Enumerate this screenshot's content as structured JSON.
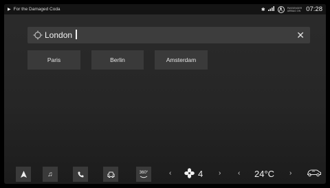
{
  "status": {
    "media_title": "For the Damaged Coda",
    "airbag_label_line1": "PASSENGER",
    "airbag_label_line2": "AIRBAG ON",
    "time": "07:28"
  },
  "search": {
    "query": "London"
  },
  "suggestions": [
    "Paris",
    "Berlin",
    "Amsterdam"
  ],
  "toolbar": {
    "view_360_label": "360°",
    "fan_level": "4",
    "temperature": "24°C"
  }
}
